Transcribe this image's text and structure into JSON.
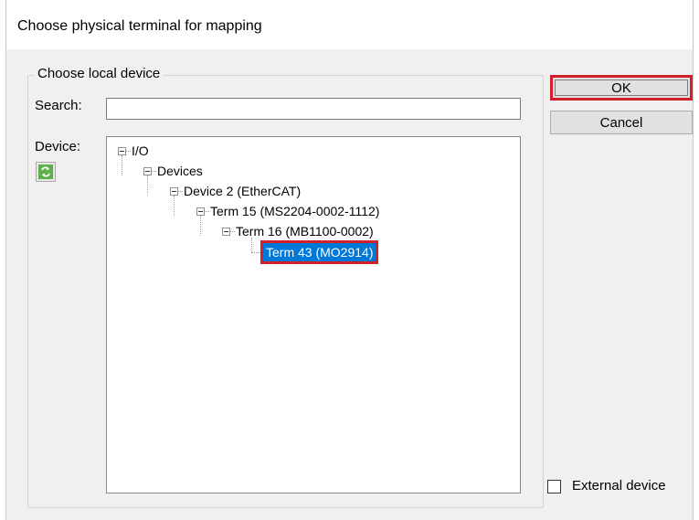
{
  "window": {
    "title": "Choose physical terminal for mapping"
  },
  "group": {
    "legend": "Choose local device"
  },
  "search": {
    "label": "Search:",
    "value": "",
    "placeholder": ""
  },
  "device": {
    "label": "Device:",
    "refresh_icon": "refresh-icon"
  },
  "tree": {
    "nodes": [
      {
        "label": "I/O",
        "level": 0,
        "expanded": true
      },
      {
        "label": "Devices",
        "level": 1,
        "expanded": true
      },
      {
        "label": "Device 2 (EtherCAT)",
        "level": 2,
        "expanded": true
      },
      {
        "label": "Term 15 (MS2204-0002-1112)",
        "level": 3,
        "expanded": true
      },
      {
        "label": "Term 16 (MB1100-0002)",
        "level": 4,
        "expanded": true
      },
      {
        "label": "Term 43 (MO2914)",
        "level": 5,
        "selected": true
      }
    ]
  },
  "buttons": {
    "ok": "OK",
    "cancel": "Cancel"
  },
  "external": {
    "label": "External device",
    "checked": false
  },
  "colors": {
    "selection": "#0078d7",
    "highlight": "#d0202a"
  }
}
